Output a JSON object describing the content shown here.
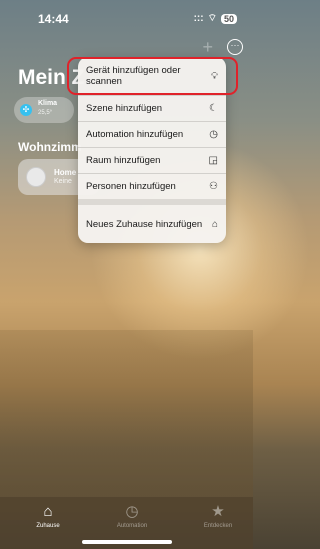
{
  "status_bar": {
    "time": "14:44",
    "signal": ":::",
    "wifi": "⌔",
    "battery": "50"
  },
  "header": {
    "title": "Mein Z",
    "plus_glyph": "+",
    "more_glyph": "···"
  },
  "climate_chip": {
    "label": "Klima",
    "value": "25,5°"
  },
  "room": {
    "title": "Wohnzimm"
  },
  "accessory": {
    "name": "Home",
    "state": "Keine"
  },
  "menu": {
    "items": [
      {
        "label": "Gerät hinzufügen oder scannen",
        "icon": "lightbulb-icon"
      },
      {
        "label": "Szene hinzufügen",
        "icon": "moon-icon"
      },
      {
        "label": "Automation hinzufügen",
        "icon": "clock-icon"
      },
      {
        "label": "Raum hinzufügen",
        "icon": "room-icon"
      },
      {
        "label": "Personen hinzufügen",
        "icon": "people-icon"
      }
    ],
    "secondary": {
      "label": "Neues Zuhause hinzufügen",
      "icon": "house-icon"
    }
  },
  "tabs": [
    {
      "label": "Zuhause",
      "icon": "house-fill-icon",
      "active": true
    },
    {
      "label": "Automation",
      "icon": "clock-fill-icon",
      "active": false
    },
    {
      "label": "Entdecken",
      "icon": "star-icon",
      "active": false
    }
  ],
  "colors": {
    "highlight": "#e0222a",
    "climate": "#36c1f0"
  }
}
